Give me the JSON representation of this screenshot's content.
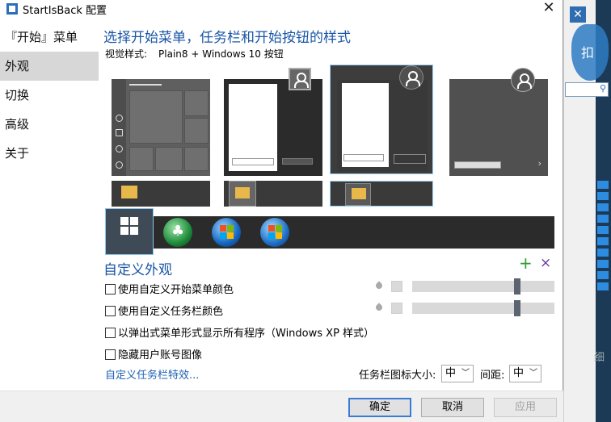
{
  "window": {
    "title": "StartIsBack 配置",
    "close_glyph": "✕"
  },
  "sidebar": {
    "items": [
      {
        "label": "『开始』菜单"
      },
      {
        "label": "外观"
      },
      {
        "label": "切换"
      },
      {
        "label": "高级"
      },
      {
        "label": "关于"
      }
    ],
    "active_index": 1
  },
  "main": {
    "heading": "选择开始菜单，任务栏和开始按钮的样式",
    "visual_style_label": "视觉样式:",
    "visual_style_value": "Plain8 + Windows 10 按钮",
    "custom_title": "自定义外观",
    "add_glyph": "+",
    "remove_glyph": "×",
    "options": [
      {
        "label": "使用自定义开始菜单颜色",
        "checked": false
      },
      {
        "label": "使用自定义任务栏颜色",
        "checked": false
      },
      {
        "label": "以弹出式菜单形式显示所有程序（Windows XP 样式）",
        "checked": false
      },
      {
        "label": "隐藏用户账号图像",
        "checked": false
      }
    ],
    "slider_levels": [
      0.75,
      0.75
    ],
    "taskbar_effects_link": "自定义任务栏特效...",
    "icon_size_label": "任务栏图标大小:",
    "icon_size_value": "中",
    "spacing_label": "间距:",
    "spacing_value": "中"
  },
  "footer": {
    "ok": "确定",
    "cancel": "取消",
    "apply": "应用"
  },
  "background": {
    "close_glyph": "✕",
    "shield_char": "扣",
    "side_text": "细"
  },
  "colors": {
    "accent": "#1a56a6",
    "selection_border": "#8cc8ef",
    "link": "#1e62b5"
  }
}
